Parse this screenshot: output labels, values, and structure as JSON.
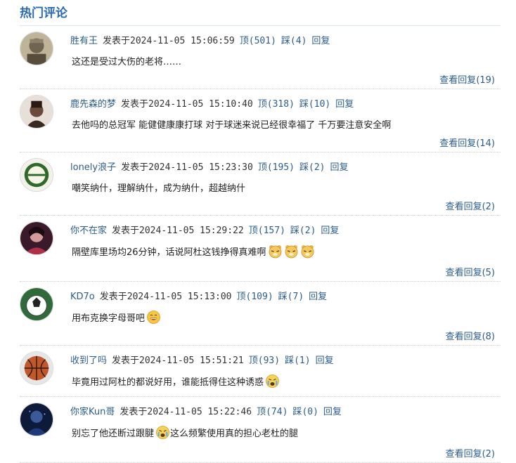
{
  "section_title": "热门评论",
  "labels": {
    "posted_at": "发表于",
    "up": "顶",
    "down": "踩",
    "reply": "回复",
    "view_replies": "查看回复"
  },
  "comments": [
    {
      "user": "胜有王",
      "time": "2024-11-05 15:06:59",
      "up": "(501)",
      "down": "(4)",
      "text": "这还是受过大伤的老将……",
      "replies": "(19)",
      "emojis": []
    },
    {
      "user": "鹿先森的梦",
      "time": "2024-11-05 15:10:40",
      "up": "(318)",
      "down": "(10)",
      "text": "去他吗的总冠军 能健健康康打球 对于球迷来说已经很幸福了 千万要注意安全啊",
      "replies": "(14)",
      "emojis": []
    },
    {
      "user": "lonely浪子",
      "time": "2024-11-05 15:23:30",
      "up": "(195)",
      "down": "(2)",
      "text": "嘲笑纳什，理解纳什，成为纳什，超越纳什",
      "replies": "(2)",
      "emojis": []
    },
    {
      "user": "你不在家",
      "time": "2024-11-05 15:29:22",
      "up": "(157)",
      "down": "(2)",
      "text": "隔壁库里场均26分钟，话说阿杜这钱挣得真难啊",
      "replies": "(5)",
      "emojis": [
        "bear-face-icon",
        "bear-face-icon",
        "bear-face-icon"
      ]
    },
    {
      "user": "KD7o",
      "time": "2024-11-05 15:13:00",
      "up": "(109)",
      "down": "(7)",
      "text": "用布克换字母哥吧",
      "replies": "(8)",
      "emojis": [
        "grin-face-icon"
      ]
    },
    {
      "user": "收到了吗",
      "time": "2024-11-05 15:51:21",
      "up": "(93)",
      "down": "(1)",
      "text": "毕竟用过阿杜的都说好用，谁能抵得住这种诱惑",
      "replies": "",
      "emojis": [
        "crying-face-icon"
      ]
    },
    {
      "user": "你家Kun哥",
      "time": "2024-11-05 15:22:46",
      "up": "(74)",
      "down": "(0)",
      "text": "别忘了他还断过跟腱",
      "text2": "这么频繁使用真的担心老杜的腿",
      "replies": "(2)",
      "emojis": [
        "crying-face-icon"
      ]
    }
  ],
  "colors": {
    "link": "#2a5d8c",
    "title": "#2a6ab0",
    "border": "#d9e6f0"
  }
}
